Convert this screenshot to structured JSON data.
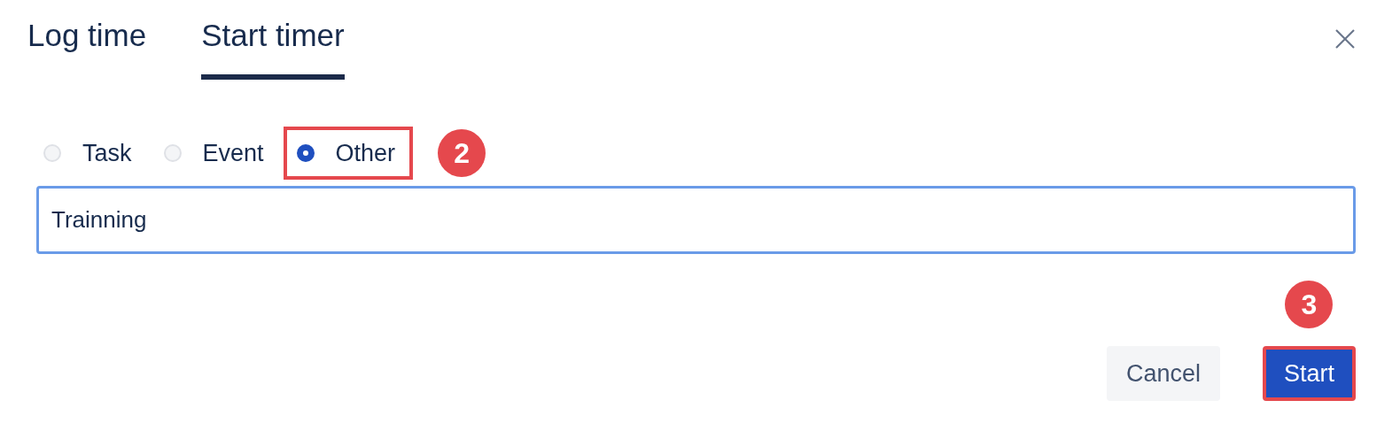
{
  "tabs": [
    {
      "label": "Log time",
      "selected": false
    },
    {
      "label": "Start timer",
      "selected": true
    }
  ],
  "entry_types": [
    {
      "label": "Task",
      "selected": false,
      "highlighted": false
    },
    {
      "label": "Event",
      "selected": false,
      "highlighted": false
    },
    {
      "label": "Other",
      "selected": true,
      "highlighted": true,
      "callout": "2"
    }
  ],
  "name_field": {
    "value": "Trainning"
  },
  "buttons": [
    {
      "label": "Cancel",
      "kind": "secondary",
      "highlighted": false
    },
    {
      "label": "Start",
      "kind": "primary",
      "highlighted": true,
      "callout": "3"
    }
  ]
}
